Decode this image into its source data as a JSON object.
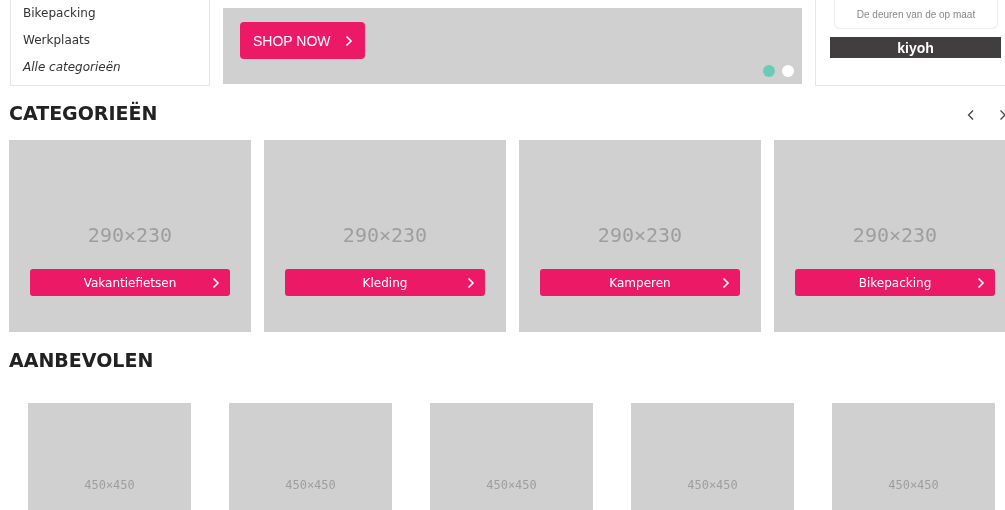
{
  "sidebar": {
    "items": [
      {
        "label": "Bikepacking",
        "kind": "link"
      },
      {
        "label": "Werkplaats",
        "kind": "link"
      },
      {
        "label": "Alle categorieën",
        "kind": "all"
      }
    ]
  },
  "banner": {
    "button": "SHOP NOW",
    "dots": [
      {
        "selected": true
      },
      {
        "selected": false
      }
    ]
  },
  "reviews": {
    "text": "De deuren van de op maat",
    "brand": "kiyoh"
  },
  "categories": {
    "title": "CATEGORIEËN",
    "items": [
      {
        "placeholder": "290×230",
        "button": "Vakantiefietsen"
      },
      {
        "placeholder": "290×230",
        "button": "Kleding"
      },
      {
        "placeholder": "290×230",
        "button": "Kamperen"
      },
      {
        "placeholder": "290×230",
        "button": "Bikepacking"
      }
    ]
  },
  "recommended": {
    "title": "AANBEVOLEN",
    "items": [
      {
        "placeholder": "450×450"
      },
      {
        "placeholder": "450×450"
      },
      {
        "placeholder": "450×450"
      },
      {
        "placeholder": "450×450"
      },
      {
        "placeholder": "450×450"
      }
    ]
  }
}
